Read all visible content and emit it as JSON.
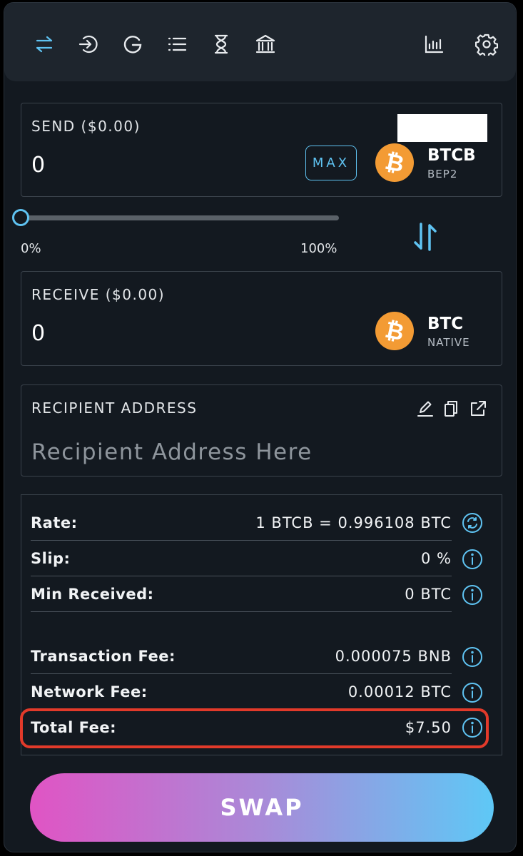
{
  "nav": {
    "icons": [
      "swap-icon",
      "sign-in-icon",
      "google-icon",
      "list-icon",
      "hourglass-icon",
      "bank-icon",
      "chart-icon",
      "gear-icon"
    ]
  },
  "send": {
    "label": "SEND ($0.00)",
    "amount": "0",
    "max_label": "MAX",
    "ticker": "BTCB",
    "chain": "BEP2"
  },
  "slider": {
    "min_label": "0%",
    "max_label": "100%",
    "value_percent": 0
  },
  "receive": {
    "label": "RECEIVE ($0.00)",
    "amount": "0",
    "ticker": "BTC",
    "chain": "NATIVE"
  },
  "recipient": {
    "label": "RECIPIENT ADDRESS",
    "placeholder": "Recipient Address Here"
  },
  "details": {
    "rate": {
      "label": "Rate:",
      "value": "1 BTCB = 0.996108 BTC"
    },
    "slip": {
      "label": "Slip:",
      "value": "0 %"
    },
    "min_received": {
      "label": "Min Received:",
      "value": "0 BTC"
    },
    "transaction_fee": {
      "label": "Transaction Fee:",
      "value": "0.000075 BNB"
    },
    "network_fee": {
      "label": "Network Fee:",
      "value": "0.00012 BTC"
    },
    "total_fee": {
      "label": "Total Fee:",
      "value": "$7.50"
    }
  },
  "swap_button": {
    "label": "SWAP"
  },
  "colors": {
    "accent": "#5fc3f2",
    "background": "#131920",
    "coin": "#f39b34",
    "highlight": "#e23a2a"
  }
}
